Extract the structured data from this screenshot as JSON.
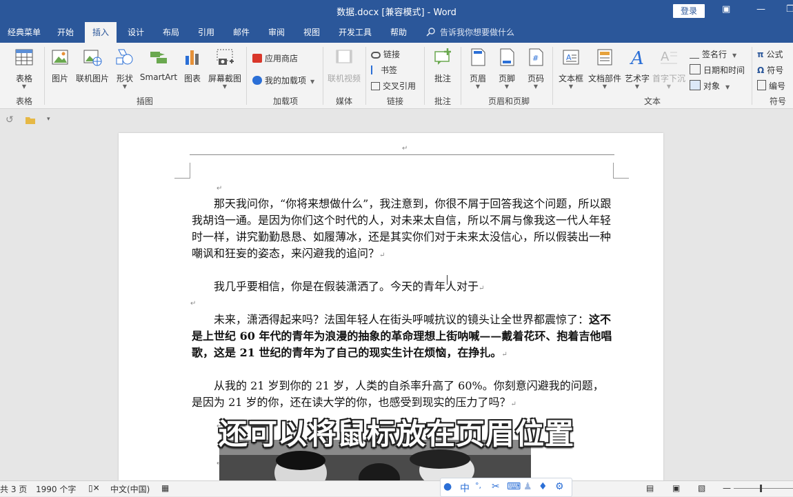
{
  "window": {
    "title": "数据.docx [兼容模式] - Word",
    "login_label": "登录",
    "controls": [
      "▣",
      "—",
      "❐"
    ]
  },
  "menu_tabs": [
    {
      "label": "经典菜单"
    },
    {
      "label": "开始"
    },
    {
      "label": "插入",
      "active": true
    },
    {
      "label": "设计"
    },
    {
      "label": "布局"
    },
    {
      "label": "引用"
    },
    {
      "label": "邮件"
    },
    {
      "label": "审阅"
    },
    {
      "label": "视图"
    },
    {
      "label": "开发工具"
    },
    {
      "label": "帮助"
    }
  ],
  "tell_me": {
    "placeholder": "告诉我你想要做什么",
    "icon": "lightbulb-icon"
  },
  "ribbon": {
    "groups": {
      "tables": "表格",
      "illustrations": "插图",
      "addins": "加载项",
      "media": "媒体",
      "links": "链接",
      "comments": "批注",
      "header_footer": "页眉和页脚",
      "text": "文本",
      "symbols": "符号"
    },
    "buttons": {
      "table": "表格",
      "picture": "图片",
      "online_picture": "联机图片",
      "shapes": "形状",
      "smartart": "SmartArt",
      "chart": "图表",
      "screenshot": "屏幕截图",
      "app_store": "应用商店",
      "my_addins": "我的加载项",
      "online_video": "联机视频",
      "link": "链接",
      "bookmark": "书签",
      "cross_ref": "交叉引用",
      "comment": "批注",
      "header": "页眉",
      "footer": "页脚",
      "page_number": "页码",
      "textbox": "文本框",
      "quick_parts": "文档部件",
      "wordart": "艺术字",
      "dropcap": "首字下沉",
      "signature_line": "签名行",
      "date_time": "日期和时间",
      "object": "对象",
      "equation": "公式",
      "symbol": "符号",
      "number": "编号"
    }
  },
  "document": {
    "paragraphs": [
      "　　那天我问你，“你将来想做什么”，我注意到，你很不屑于回答我这个问题，所以跟我胡诌一通。是因为你们这个时代的人，对未来太自信，所以不屑与像我这一代人年轻时一样，讲究勤勤恳恳、如履薄冰，还是其实你们对于未来太没信心，所以假装出一种嘲讽和狂妄的姿态，来闪避我的追问？",
      "　　我几乎要相信，你是在假装潇洒了。今天的青年人对于",
      "　　未来，潇洒得起来吗？法国年轻人在街头呼喊抗议的镜头让全世界都震惊了：",
      "这不是上世纪 60 年代的青年为浪漫的抽象的革命理想上街呐喊——戴着花环、抱着吉他唱歌，这是 21 世纪的青年为了自己的现实生计在烦恼，在挣扎。",
      "　　从我的 21 岁到你的 21 岁，人类的自杀率升高了 60%。你刻意闪避我的问题，是因为 21 岁的你，还在读大学的你，也感受到现实的压力了吗？"
    ],
    "para_mark": "↵"
  },
  "subtitle": "还可以将鼠标放在页眉位置",
  "status": {
    "pages": "共 3 页",
    "words": "1990 个字",
    "language": "中文(中国)"
  },
  "ime": {
    "lang": "中",
    "punct": "°,"
  },
  "colors": {
    "brand": "#2b579a",
    "ribbon_bg": "#f3f3f3",
    "canvas_bg": "#e6e6e6"
  }
}
